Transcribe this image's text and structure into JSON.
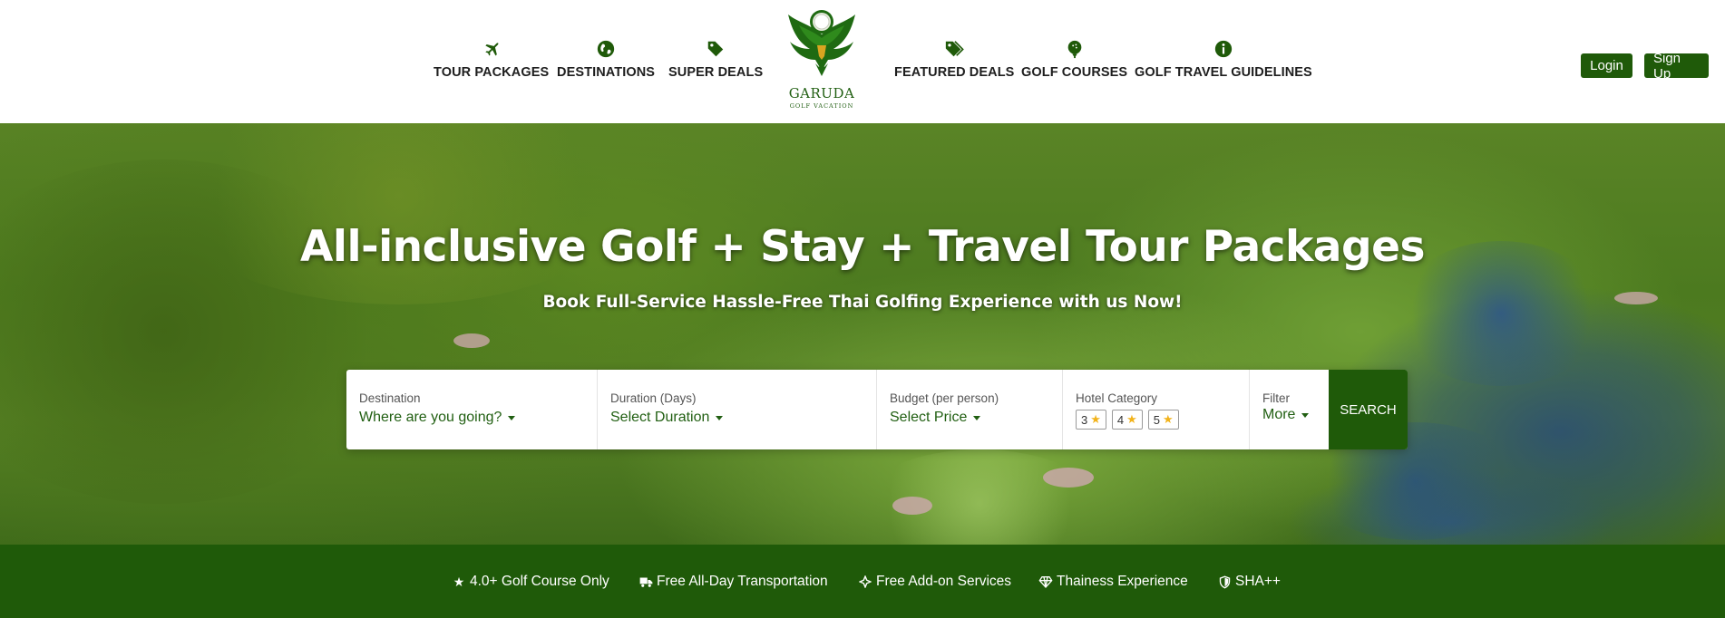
{
  "nav": {
    "left": [
      {
        "label": "TOUR PACKAGES",
        "icon": "airplane-icon"
      },
      {
        "label": "DESTINATIONS",
        "icon": "globe-icon"
      },
      {
        "label": "SUPER DEALS",
        "icon": "tag-icon"
      }
    ],
    "right": [
      {
        "label": "FEATURED DEALS",
        "icon": "tags-icon"
      },
      {
        "label": "GOLF COURSES",
        "icon": "golf-ball-icon"
      },
      {
        "label": "GOLF TRAVEL GUIDELINES",
        "icon": "info-icon"
      }
    ]
  },
  "logo": {
    "name": "GARUDA",
    "sub": "GOLF VACATION"
  },
  "auth": {
    "login": "Login",
    "signup": "Sign Up"
  },
  "hero": {
    "title": "All-inclusive Golf + Stay + Travel Tour Packages",
    "subtitle": "Book Full-Service Hassle-Free Thai Golfing Experience with us Now!"
  },
  "search": {
    "destination": {
      "label": "Destination",
      "value": "Where are you going?"
    },
    "duration": {
      "label": "Duration (Days)",
      "value": "Select Duration"
    },
    "budget": {
      "label": "Budget (per person)",
      "value": "Select Price"
    },
    "hotel": {
      "label": "Hotel Category",
      "options": [
        "3",
        "4",
        "5"
      ]
    },
    "filter": {
      "label": "Filter",
      "value": "More"
    },
    "button": "SEARCH"
  },
  "features": [
    {
      "label": "4.0+ Golf Course Only",
      "icon": "star-icon"
    },
    {
      "label": "Free All-Day Transportation",
      "icon": "truck-icon"
    },
    {
      "label": "Free Add-on Services",
      "icon": "sparkle-icon"
    },
    {
      "label": "Thainess Experience",
      "icon": "diamond-icon"
    },
    {
      "label": "SHA++",
      "icon": "shield-icon"
    }
  ],
  "colors": {
    "brand_green": "#1f5a09",
    "accent_gold": "#f2b31b"
  }
}
